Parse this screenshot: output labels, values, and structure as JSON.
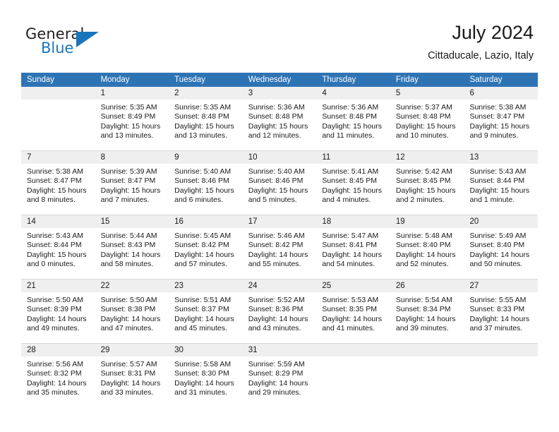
{
  "brand": {
    "name_part1": "General",
    "name_part2": "Blue",
    "logo_icon": "triangle-logo-icon"
  },
  "header": {
    "title": "July 2024",
    "subtitle": "Cittaducale, Lazio, Italy"
  },
  "calendar": {
    "day_headers": [
      "Sunday",
      "Monday",
      "Tuesday",
      "Wednesday",
      "Thursday",
      "Friday",
      "Saturday"
    ],
    "colors": {
      "header_band": "#2e74b5",
      "date_band": "#efefef",
      "brand_blue": "#1b75bb"
    },
    "weeks": [
      {
        "dates": [
          "",
          "1",
          "2",
          "3",
          "4",
          "5",
          "6"
        ],
        "cells": [
          {
            "sunrise": "",
            "sunset": "",
            "daylight1": "",
            "daylight2": ""
          },
          {
            "sunrise": "Sunrise: 5:35 AM",
            "sunset": "Sunset: 8:49 PM",
            "daylight1": "Daylight: 15 hours",
            "daylight2": "and 13 minutes."
          },
          {
            "sunrise": "Sunrise: 5:35 AM",
            "sunset": "Sunset: 8:48 PM",
            "daylight1": "Daylight: 15 hours",
            "daylight2": "and 13 minutes."
          },
          {
            "sunrise": "Sunrise: 5:36 AM",
            "sunset": "Sunset: 8:48 PM",
            "daylight1": "Daylight: 15 hours",
            "daylight2": "and 12 minutes."
          },
          {
            "sunrise": "Sunrise: 5:36 AM",
            "sunset": "Sunset: 8:48 PM",
            "daylight1": "Daylight: 15 hours",
            "daylight2": "and 11 minutes."
          },
          {
            "sunrise": "Sunrise: 5:37 AM",
            "sunset": "Sunset: 8:48 PM",
            "daylight1": "Daylight: 15 hours",
            "daylight2": "and 10 minutes."
          },
          {
            "sunrise": "Sunrise: 5:38 AM",
            "sunset": "Sunset: 8:47 PM",
            "daylight1": "Daylight: 15 hours",
            "daylight2": "and 9 minutes."
          }
        ]
      },
      {
        "dates": [
          "7",
          "8",
          "9",
          "10",
          "11",
          "12",
          "13"
        ],
        "cells": [
          {
            "sunrise": "Sunrise: 5:38 AM",
            "sunset": "Sunset: 8:47 PM",
            "daylight1": "Daylight: 15 hours",
            "daylight2": "and 8 minutes."
          },
          {
            "sunrise": "Sunrise: 5:39 AM",
            "sunset": "Sunset: 8:47 PM",
            "daylight1": "Daylight: 15 hours",
            "daylight2": "and 7 minutes."
          },
          {
            "sunrise": "Sunrise: 5:40 AM",
            "sunset": "Sunset: 8:46 PM",
            "daylight1": "Daylight: 15 hours",
            "daylight2": "and 6 minutes."
          },
          {
            "sunrise": "Sunrise: 5:40 AM",
            "sunset": "Sunset: 8:46 PM",
            "daylight1": "Daylight: 15 hours",
            "daylight2": "and 5 minutes."
          },
          {
            "sunrise": "Sunrise: 5:41 AM",
            "sunset": "Sunset: 8:45 PM",
            "daylight1": "Daylight: 15 hours",
            "daylight2": "and 4 minutes."
          },
          {
            "sunrise": "Sunrise: 5:42 AM",
            "sunset": "Sunset: 8:45 PM",
            "daylight1": "Daylight: 15 hours",
            "daylight2": "and 2 minutes."
          },
          {
            "sunrise": "Sunrise: 5:43 AM",
            "sunset": "Sunset: 8:44 PM",
            "daylight1": "Daylight: 15 hours",
            "daylight2": "and 1 minute."
          }
        ]
      },
      {
        "dates": [
          "14",
          "15",
          "16",
          "17",
          "18",
          "19",
          "20"
        ],
        "cells": [
          {
            "sunrise": "Sunrise: 5:43 AM",
            "sunset": "Sunset: 8:44 PM",
            "daylight1": "Daylight: 15 hours",
            "daylight2": "and 0 minutes."
          },
          {
            "sunrise": "Sunrise: 5:44 AM",
            "sunset": "Sunset: 8:43 PM",
            "daylight1": "Daylight: 14 hours",
            "daylight2": "and 58 minutes."
          },
          {
            "sunrise": "Sunrise: 5:45 AM",
            "sunset": "Sunset: 8:42 PM",
            "daylight1": "Daylight: 14 hours",
            "daylight2": "and 57 minutes."
          },
          {
            "sunrise": "Sunrise: 5:46 AM",
            "sunset": "Sunset: 8:42 PM",
            "daylight1": "Daylight: 14 hours",
            "daylight2": "and 55 minutes."
          },
          {
            "sunrise": "Sunrise: 5:47 AM",
            "sunset": "Sunset: 8:41 PM",
            "daylight1": "Daylight: 14 hours",
            "daylight2": "and 54 minutes."
          },
          {
            "sunrise": "Sunrise: 5:48 AM",
            "sunset": "Sunset: 8:40 PM",
            "daylight1": "Daylight: 14 hours",
            "daylight2": "and 52 minutes."
          },
          {
            "sunrise": "Sunrise: 5:49 AM",
            "sunset": "Sunset: 8:40 PM",
            "daylight1": "Daylight: 14 hours",
            "daylight2": "and 50 minutes."
          }
        ]
      },
      {
        "dates": [
          "21",
          "22",
          "23",
          "24",
          "25",
          "26",
          "27"
        ],
        "cells": [
          {
            "sunrise": "Sunrise: 5:50 AM",
            "sunset": "Sunset: 8:39 PM",
            "daylight1": "Daylight: 14 hours",
            "daylight2": "and 49 minutes."
          },
          {
            "sunrise": "Sunrise: 5:50 AM",
            "sunset": "Sunset: 8:38 PM",
            "daylight1": "Daylight: 14 hours",
            "daylight2": "and 47 minutes."
          },
          {
            "sunrise": "Sunrise: 5:51 AM",
            "sunset": "Sunset: 8:37 PM",
            "daylight1": "Daylight: 14 hours",
            "daylight2": "and 45 minutes."
          },
          {
            "sunrise": "Sunrise: 5:52 AM",
            "sunset": "Sunset: 8:36 PM",
            "daylight1": "Daylight: 14 hours",
            "daylight2": "and 43 minutes."
          },
          {
            "sunrise": "Sunrise: 5:53 AM",
            "sunset": "Sunset: 8:35 PM",
            "daylight1": "Daylight: 14 hours",
            "daylight2": "and 41 minutes."
          },
          {
            "sunrise": "Sunrise: 5:54 AM",
            "sunset": "Sunset: 8:34 PM",
            "daylight1": "Daylight: 14 hours",
            "daylight2": "and 39 minutes."
          },
          {
            "sunrise": "Sunrise: 5:55 AM",
            "sunset": "Sunset: 8:33 PM",
            "daylight1": "Daylight: 14 hours",
            "daylight2": "and 37 minutes."
          }
        ]
      },
      {
        "dates": [
          "28",
          "29",
          "30",
          "31",
          "",
          "",
          ""
        ],
        "cells": [
          {
            "sunrise": "Sunrise: 5:56 AM",
            "sunset": "Sunset: 8:32 PM",
            "daylight1": "Daylight: 14 hours",
            "daylight2": "and 35 minutes."
          },
          {
            "sunrise": "Sunrise: 5:57 AM",
            "sunset": "Sunset: 8:31 PM",
            "daylight1": "Daylight: 14 hours",
            "daylight2": "and 33 minutes."
          },
          {
            "sunrise": "Sunrise: 5:58 AM",
            "sunset": "Sunset: 8:30 PM",
            "daylight1": "Daylight: 14 hours",
            "daylight2": "and 31 minutes."
          },
          {
            "sunrise": "Sunrise: 5:59 AM",
            "sunset": "Sunset: 8:29 PM",
            "daylight1": "Daylight: 14 hours",
            "daylight2": "and 29 minutes."
          },
          {
            "sunrise": "",
            "sunset": "",
            "daylight1": "",
            "daylight2": ""
          },
          {
            "sunrise": "",
            "sunset": "",
            "daylight1": "",
            "daylight2": ""
          },
          {
            "sunrise": "",
            "sunset": "",
            "daylight1": "",
            "daylight2": ""
          }
        ]
      }
    ]
  }
}
